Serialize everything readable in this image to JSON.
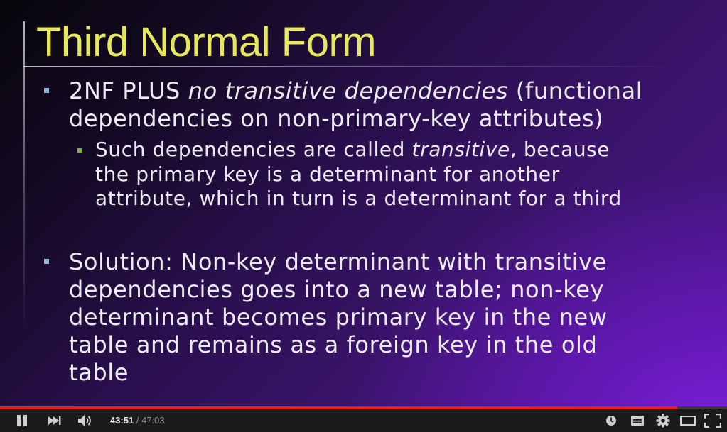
{
  "slide": {
    "title": "Third Normal Form",
    "bullet1": {
      "prefix": "2NF PLUS ",
      "emphasis": "no transitive dependencies",
      "suffix": " (functional",
      "line2": "dependencies on non-primary-key attributes)"
    },
    "sub_bullet": {
      "line1_prefix": "Such dependencies are called ",
      "line1_emphasis": "transitive",
      "line1_suffix": ", because",
      "line2": "the primary key is a determinant for another",
      "line3": "attribute, which in turn is a determinant for a third"
    },
    "bullet2": {
      "line1": "Solution: Non-key determinant with transitive",
      "line2": "dependencies goes into a new table; non-key",
      "line3": "determinant becomes primary key in the new",
      "line4": "table and remains as a foreign key in the old",
      "line5": "table"
    }
  },
  "player": {
    "current_time": "43:51",
    "separator": " / ",
    "duration": "47:03",
    "progress_fraction": 0.932,
    "progress_color": "#e62117",
    "icons": {
      "play_pause": "pause-icon",
      "next": "next-icon",
      "volume": "volume-icon",
      "watch_later": "clock-icon",
      "captions": "captions-icon",
      "settings": "gear-icon",
      "theater": "theater-mode-icon",
      "fullscreen": "fullscreen-icon"
    }
  }
}
